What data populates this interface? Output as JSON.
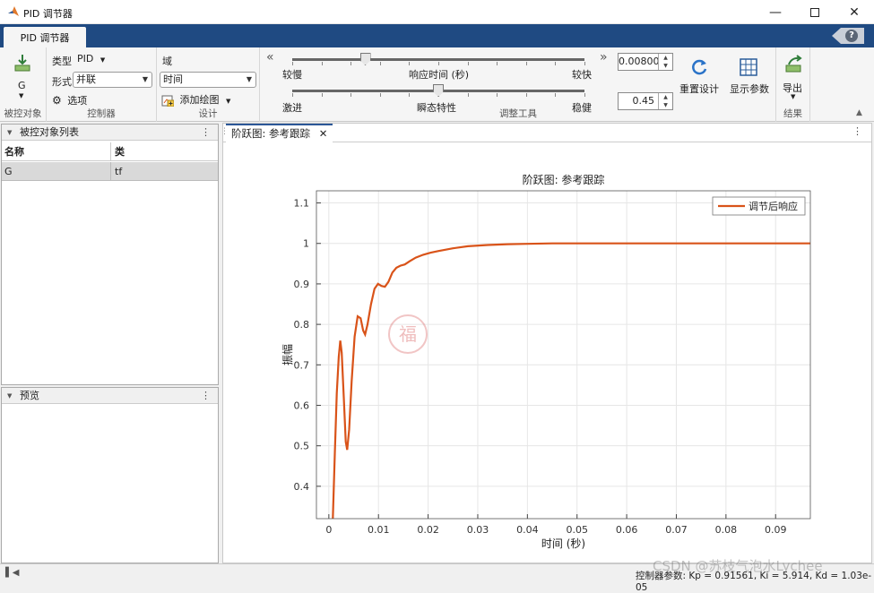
{
  "window": {
    "title": "PID 调节器",
    "minimize_icon": "minimize-icon",
    "maximize_icon": "maximize-icon",
    "close_icon": "close-icon"
  },
  "ribbon_tab": {
    "label": "PID 调节器",
    "help_label": "?"
  },
  "plant_section": {
    "plant_name": "G",
    "label": "被控对象"
  },
  "controller_section": {
    "type_label": "类型",
    "type_value": "PID",
    "form_label": "形式",
    "form_value": "并联",
    "options_label": "选项",
    "label": "控制器"
  },
  "design_section": {
    "domain_label": "域",
    "domain_value": "时间",
    "add_plot_label": "添加绘图",
    "label": "设计"
  },
  "tuning_section": {
    "slow_label": "较慢",
    "response_time_label": "响应时间 (秒)",
    "fast_label": "较快",
    "response_time_value": "0.00800",
    "response_slider_level": 0.25,
    "aggressive_label": "激进",
    "transient_label": "瞬态特性",
    "robust_label": "稳健",
    "transient_value": "0.45",
    "transient_slider_level": 0.5,
    "reset_label": "重置设计",
    "show_params_label": "显示参数",
    "label": "调整工具"
  },
  "result_section": {
    "export_label": "导出",
    "label": "结果"
  },
  "plant_list": {
    "title": "被控对象列表",
    "columns": [
      "名称",
      "类"
    ],
    "rows": [
      {
        "name": "G",
        "class": "tf"
      }
    ]
  },
  "preview": {
    "title": "预览"
  },
  "figure_tab": {
    "label": "阶跃图: 参考跟踪"
  },
  "status": {
    "text": "控制器参数: Kp = 0.91561, Ki = 5.914, Kd = 1.03e-05"
  },
  "watermark": {
    "text": "CSDN @苏枝气泡水Lychee"
  },
  "colors": {
    "ribbon_blue": "#1f4a82",
    "series": "#d95319"
  },
  "chart_data": {
    "type": "line",
    "title": "阶跃图: 参考跟踪",
    "xlabel": "时间 (秒)",
    "ylabel": "振幅",
    "xlim": [
      -0.0025,
      0.097
    ],
    "ylim": [
      0.32,
      1.13
    ],
    "xticks": [
      "0",
      "0.01",
      "0.02",
      "0.03",
      "0.04",
      "0.05",
      "0.06",
      "0.07",
      "0.08",
      "0.09"
    ],
    "xtick_values": [
      0,
      0.01,
      0.02,
      0.03,
      0.04,
      0.05,
      0.06,
      0.07,
      0.08,
      0.09
    ],
    "yticks": [
      "0.4",
      "0.5",
      "0.6",
      "0.7",
      "0.8",
      "0.9",
      "1",
      "1.1"
    ],
    "ytick_values": [
      0.4,
      0.5,
      0.6,
      0.7,
      0.8,
      0.9,
      1.0,
      1.1
    ],
    "grid": true,
    "legend_position": "top-right",
    "series": [
      {
        "name": "调节后响应",
        "x": [
          0.0008,
          0.0012,
          0.0016,
          0.002,
          0.0023,
          0.0026,
          0.003,
          0.0034,
          0.0037,
          0.0041,
          0.0046,
          0.0052,
          0.0058,
          0.0064,
          0.0069,
          0.0073,
          0.0078,
          0.0085,
          0.0092,
          0.0099,
          0.0106,
          0.0113,
          0.012,
          0.0128,
          0.0136,
          0.0144,
          0.0153,
          0.0163,
          0.0175,
          0.019,
          0.0205,
          0.022,
          0.025,
          0.028,
          0.032,
          0.036,
          0.04,
          0.045,
          0.05,
          0.06,
          0.07,
          0.08,
          0.09,
          0.097
        ],
        "y": [
          0.32,
          0.48,
          0.63,
          0.72,
          0.76,
          0.73,
          0.62,
          0.51,
          0.49,
          0.54,
          0.66,
          0.77,
          0.82,
          0.815,
          0.785,
          0.775,
          0.8,
          0.85,
          0.888,
          0.9,
          0.895,
          0.893,
          0.905,
          0.928,
          0.94,
          0.945,
          0.948,
          0.956,
          0.965,
          0.972,
          0.977,
          0.981,
          0.988,
          0.993,
          0.996,
          0.998,
          0.999,
          1.0,
          1.0,
          1.0,
          1.0,
          1.0,
          1.0,
          1.0
        ]
      }
    ]
  }
}
